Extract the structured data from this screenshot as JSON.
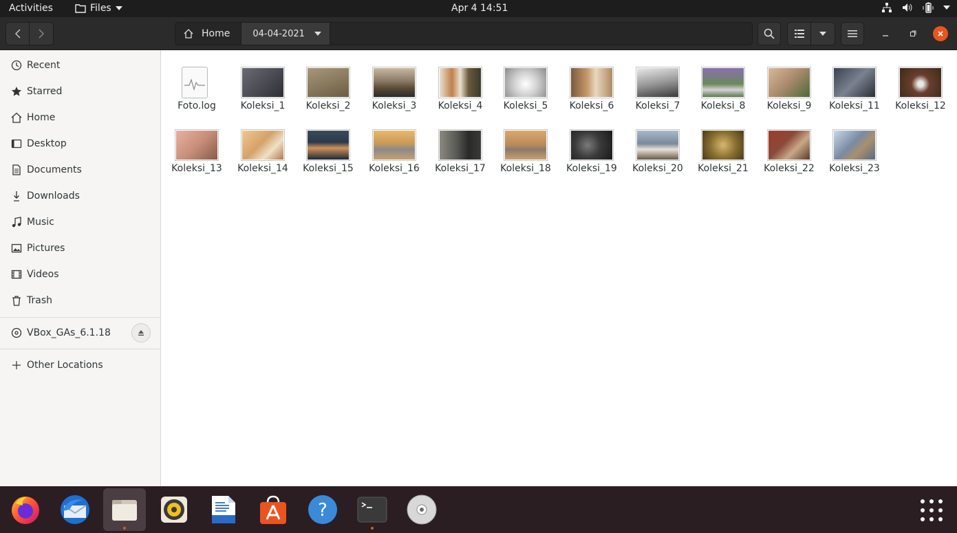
{
  "topbar": {
    "activities": "Activities",
    "app_menu": "Files",
    "clock": "Apr 4  14:51",
    "tray_icons": [
      "network-icon",
      "volume-icon",
      "battery-icon",
      "power-icon"
    ]
  },
  "headerbar": {
    "path": [
      "Home",
      "04-04-2021"
    ]
  },
  "sidebar": {
    "items": [
      {
        "label": "Recent",
        "icon": "clock-icon"
      },
      {
        "label": "Starred",
        "icon": "star-icon"
      },
      {
        "label": "Home",
        "icon": "home-icon"
      },
      {
        "label": "Desktop",
        "icon": "desktop-icon"
      },
      {
        "label": "Documents",
        "icon": "document-icon"
      },
      {
        "label": "Downloads",
        "icon": "download-icon"
      },
      {
        "label": "Music",
        "icon": "music-icon"
      },
      {
        "label": "Pictures",
        "icon": "picture-icon"
      },
      {
        "label": "Videos",
        "icon": "video-icon"
      },
      {
        "label": "Trash",
        "icon": "trash-icon"
      }
    ],
    "device": {
      "label": "VBox_GAs_6.1.18",
      "icon": "disc-icon"
    },
    "other": {
      "label": "Other Locations",
      "icon": "plus-icon"
    }
  },
  "files": [
    {
      "name": "Foto.log",
      "type": "log"
    },
    {
      "name": "Koleksi_1",
      "color": "#4a4a52"
    },
    {
      "name": "Koleksi_2",
      "color": "#8a7a5e"
    },
    {
      "name": "Koleksi_3",
      "color": "#6b5a44"
    },
    {
      "name": "Koleksi_4",
      "color": "#a0703c"
    },
    {
      "name": "Koleksi_5",
      "color": "#d8d8d8"
    },
    {
      "name": "Koleksi_6",
      "color": "#b08a62"
    },
    {
      "name": "Koleksi_7",
      "color": "#9a9a9a"
    },
    {
      "name": "Koleksi_8",
      "color": "#8a6fb2"
    },
    {
      "name": "Koleksi_9",
      "color": "#a88a6a"
    },
    {
      "name": "Koleksi_11",
      "color": "#5a6270"
    },
    {
      "name": "Koleksi_12",
      "color": "#6a3e2c"
    },
    {
      "name": "Koleksi_13",
      "color": "#c8907a"
    },
    {
      "name": "Koleksi_14",
      "color": "#d4a26a"
    },
    {
      "name": "Koleksi_15",
      "color": "#3a4a5a"
    },
    {
      "name": "Koleksi_16",
      "color": "#c89a5a"
    },
    {
      "name": "Koleksi_17",
      "color": "#5a5a56"
    },
    {
      "name": "Koleksi_18",
      "color": "#b88a5a"
    },
    {
      "name": "Koleksi_19",
      "color": "#3a3a3a"
    },
    {
      "name": "Koleksi_20",
      "color": "#7a8a9a"
    },
    {
      "name": "Koleksi_21",
      "color": "#8a7030"
    },
    {
      "name": "Koleksi_22",
      "color": "#8a4a3a"
    },
    {
      "name": "Koleksi_23",
      "color": "#7a8aa2"
    }
  ],
  "dock": {
    "apps": [
      "firefox-icon",
      "thunderbird-icon",
      "files-icon",
      "rhythmbox-icon",
      "writer-icon",
      "software-icon",
      "help-icon",
      "terminal-icon",
      "cd-icon",
      "show-apps-icon"
    ]
  },
  "colors": {
    "accent": "#e95420",
    "topbar": "#1d1d1d",
    "headerbar": "#2b2b2b",
    "sidebar": "#f6f5f4",
    "dock": "#2a1e23"
  }
}
